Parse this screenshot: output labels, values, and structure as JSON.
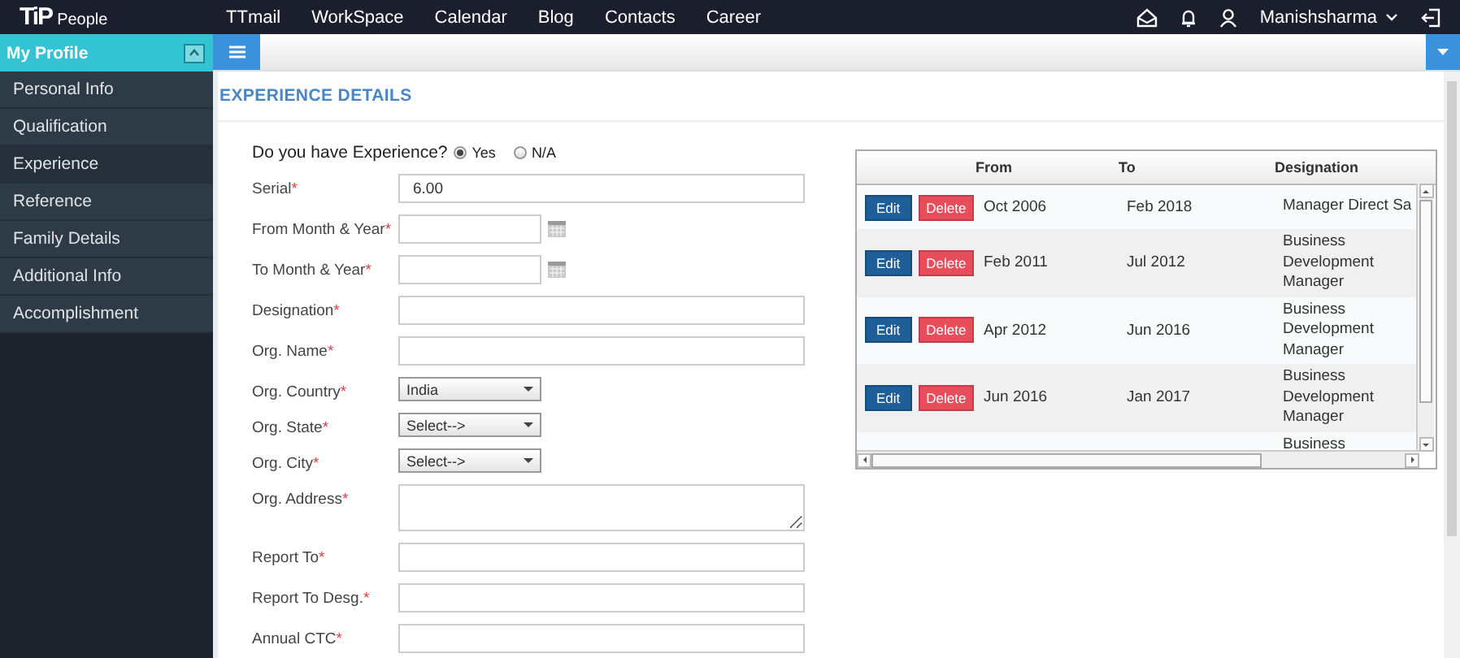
{
  "topbar": {
    "logo_mark": "TiP",
    "logo_text": "People",
    "nav": [
      "TTmail",
      "WorkSpace",
      "Calendar",
      "Blog",
      "Contacts",
      "Career"
    ],
    "user": "Manishsharma"
  },
  "sidebar": {
    "title": "My Profile",
    "expanded": true,
    "items": [
      {
        "label": "Personal Info",
        "selected": false
      },
      {
        "label": "Qualification",
        "selected": false
      },
      {
        "label": "Experience",
        "selected": true
      },
      {
        "label": "Reference",
        "selected": false
      },
      {
        "label": "Family Details",
        "selected": false
      },
      {
        "label": "Additional Info",
        "selected": false
      },
      {
        "label": "Accomplishment",
        "selected": false
      }
    ]
  },
  "section_title": "EXPERIENCE DETAILS",
  "experience_question": {
    "label": "Do you have Experience?",
    "options": [
      {
        "label": "Yes",
        "selected": true
      },
      {
        "label": "N/A",
        "selected": false
      }
    ]
  },
  "form": {
    "fields": [
      {
        "label": "Serial",
        "mark": "*",
        "kind": "text",
        "value": "6.00"
      },
      {
        "label": "From Month & Year",
        "mark": "*",
        "kind": "date"
      },
      {
        "label": "To Month & Year",
        "mark": "*",
        "kind": "date"
      },
      {
        "label": "Designation",
        "mark": "*",
        "kind": "text"
      },
      {
        "label": "Org. Name",
        "mark": "*",
        "kind": "text"
      },
      {
        "label": "Org. Country",
        "mark": "*",
        "kind": "select",
        "value": "India"
      },
      {
        "label": "Org. State",
        "mark": "*",
        "kind": "select",
        "value": "Select-->"
      },
      {
        "label": "Org. City",
        "mark": "*",
        "kind": "select",
        "value": "Select-->"
      },
      {
        "label": "Org. Address",
        "mark": "*",
        "kind": "textarea"
      },
      {
        "label": "Report To",
        "mark": "*",
        "kind": "text"
      },
      {
        "label": "Report To Desg.",
        "mark": "*",
        "kind": "text"
      },
      {
        "label": "Annual CTC",
        "mark": "*",
        "kind": "text"
      }
    ]
  },
  "grid": {
    "columns": [
      "From",
      "To",
      "Designation"
    ],
    "rows": [
      {
        "edit": "Edit",
        "delete": "Delete",
        "from": "Oct 2006",
        "to": "Feb 2018",
        "designation": "Manager Direct Sa"
      },
      {
        "edit": "Edit",
        "delete": "Delete",
        "from": "Feb 2011",
        "to": "Jul 2012",
        "designation": "Business Development Manager"
      },
      {
        "edit": "Edit",
        "delete": "Delete",
        "from": "Apr 2012",
        "to": "Jun 2016",
        "designation": "Business Development Manager"
      },
      {
        "edit": "Edit",
        "delete": "Delete",
        "from": "Jun 2016",
        "to": "Jan 2017",
        "designation": "Business Development Manager"
      },
      {
        "designation": "Business"
      }
    ]
  }
}
